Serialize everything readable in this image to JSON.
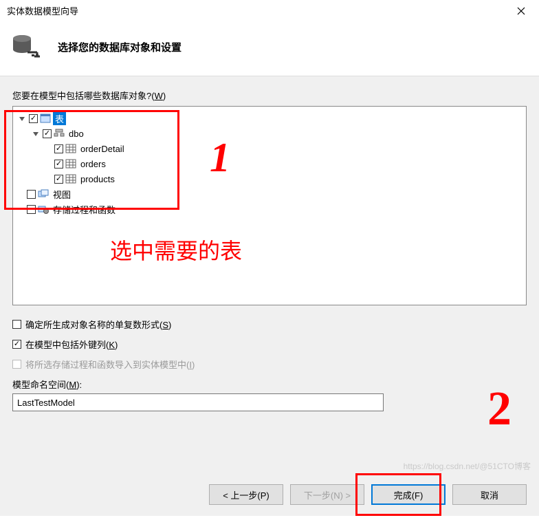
{
  "window": {
    "title": "实体数据模型向导"
  },
  "header": {
    "title": "选择您的数据库对象和设置"
  },
  "prompt": {
    "label_pre": "您要在模型中包括哪些数据库对象?(",
    "label_accel": "W",
    "label_post": ")"
  },
  "tree": {
    "tables": {
      "label": "表",
      "expanded": true,
      "checked": true,
      "dbo": {
        "label": "dbo",
        "expanded": true,
        "checked": true,
        "children": [
          {
            "label": "orderDetail",
            "checked": true
          },
          {
            "label": "orders",
            "checked": true
          },
          {
            "label": "products",
            "checked": true
          }
        ]
      }
    },
    "views": {
      "label": "视图",
      "checked": false
    },
    "sprocs": {
      "label": "存储过程和函数",
      "checked": false
    }
  },
  "options": {
    "pluralize": {
      "label": "确定所生成对象名称的单复数形式(",
      "accel": "S",
      "post": ")",
      "checked": false
    },
    "fkeys": {
      "label": "在模型中包括外键列(",
      "accel": "K",
      "post": ")",
      "checked": true
    },
    "importSp": {
      "label": "将所选存储过程和函数导入到实体模型中(",
      "accel": "I",
      "post": ")",
      "checked": false,
      "disabled": true
    }
  },
  "namespace": {
    "label_pre": "模型命名空间(",
    "label_accel": "M",
    "label_post": "):",
    "value": "LastTestModel"
  },
  "buttons": {
    "prev": "< 上一步(P)",
    "next": "下一步(N) >",
    "finish": "完成(F)",
    "cancel": "取消"
  },
  "annotations": {
    "mark1": "1",
    "text1": "选中需要的表",
    "mark2": "2"
  },
  "watermark": "https://blog.csdn.net/@51CTO博客"
}
